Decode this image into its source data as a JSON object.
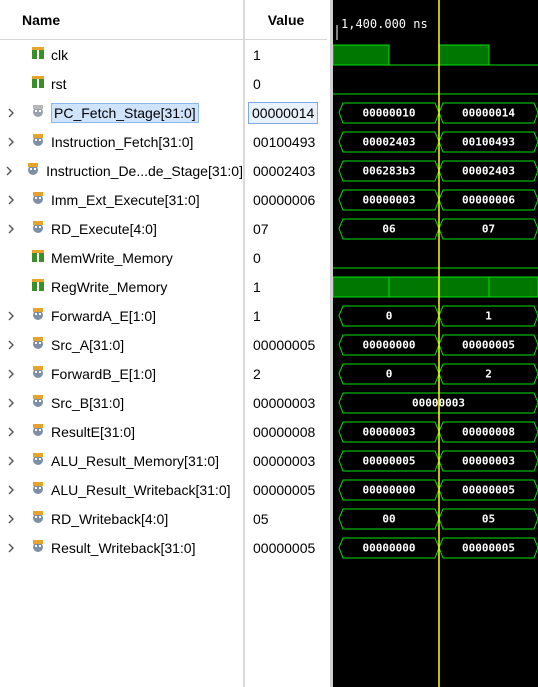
{
  "columns": {
    "name_header": "Name",
    "value_header": "Value"
  },
  "timeline": {
    "cursor_label": "1,400.000 ns"
  },
  "colors": {
    "wave": "#00e000",
    "bus_fill": "#000000",
    "high_fill": "#007700",
    "cursor": "#ffff00",
    "background": "#000000"
  },
  "signals": [
    {
      "name": "clk",
      "value": "1",
      "kind": "bit",
      "icon": "logic-bit-icon",
      "expandable": false,
      "waves": [
        1,
        0,
        1,
        0
      ]
    },
    {
      "name": "rst",
      "value": "0",
      "kind": "bit",
      "icon": "logic-bit-icon",
      "expandable": false,
      "waves": [
        0,
        0,
        0,
        0
      ]
    },
    {
      "name": "PC_Fetch_Stage[31:0]",
      "value": "00000014",
      "kind": "bus",
      "icon": "bus-icon",
      "expandable": true,
      "selected": true,
      "segments": [
        "00000010",
        "00000014"
      ]
    },
    {
      "name": "Instruction_Fetch[31:0]",
      "value": "00100493",
      "kind": "bus",
      "icon": "bus-icon",
      "expandable": true,
      "segments": [
        "00002403",
        "00100493"
      ]
    },
    {
      "name": "Instruction_De...de_Stage[31:0]",
      "value": "00002403",
      "kind": "bus",
      "icon": "bus-icon",
      "expandable": true,
      "segments": [
        "006283b3",
        "00002403"
      ]
    },
    {
      "name": "Imm_Ext_Execute[31:0]",
      "value": "00000006",
      "kind": "bus",
      "icon": "bus-icon",
      "expandable": true,
      "segments": [
        "00000003",
        "00000006"
      ]
    },
    {
      "name": "RD_Execute[4:0]",
      "value": "07",
      "kind": "bus",
      "icon": "bus-icon",
      "expandable": true,
      "segments": [
        "06",
        "07"
      ]
    },
    {
      "name": "MemWrite_Memory",
      "value": "0",
      "kind": "bit",
      "icon": "logic-bit-icon",
      "expandable": false,
      "waves": [
        0,
        0,
        0,
        0
      ]
    },
    {
      "name": "RegWrite_Memory",
      "value": "1",
      "kind": "bit",
      "icon": "logic-bit-icon",
      "expandable": false,
      "waves": [
        1,
        1,
        1,
        1
      ]
    },
    {
      "name": "ForwardA_E[1:0]",
      "value": "1",
      "kind": "bus",
      "icon": "bus-icon",
      "expandable": true,
      "segments": [
        "0",
        "1"
      ]
    },
    {
      "name": "Src_A[31:0]",
      "value": "00000005",
      "kind": "bus",
      "icon": "bus-icon",
      "expandable": true,
      "segments": [
        "00000000",
        "00000005"
      ]
    },
    {
      "name": "ForwardB_E[1:0]",
      "value": "2",
      "kind": "bus",
      "icon": "bus-icon",
      "expandable": true,
      "segments": [
        "0",
        "2"
      ]
    },
    {
      "name": "Src_B[31:0]",
      "value": "00000003",
      "kind": "bus",
      "icon": "bus-icon",
      "expandable": true,
      "segments": [
        "00000003"
      ]
    },
    {
      "name": "ResultE[31:0]",
      "value": "00000008",
      "kind": "bus",
      "icon": "bus-icon",
      "expandable": true,
      "segments": [
        "00000003",
        "00000008"
      ]
    },
    {
      "name": "ALU_Result_Memory[31:0]",
      "value": "00000003",
      "kind": "bus",
      "icon": "bus-icon",
      "expandable": true,
      "segments": [
        "00000005",
        "00000003"
      ]
    },
    {
      "name": "ALU_Result_Writeback[31:0]",
      "value": "00000005",
      "kind": "bus",
      "icon": "bus-icon",
      "expandable": true,
      "segments": [
        "00000000",
        "00000005"
      ]
    },
    {
      "name": "RD_Writeback[4:0]",
      "value": "05",
      "kind": "bus",
      "icon": "bus-icon",
      "expandable": true,
      "segments": [
        "00",
        "05"
      ]
    },
    {
      "name": "Result_Writeback[31:0]",
      "value": "00000005",
      "kind": "bus",
      "icon": "bus-icon",
      "expandable": true,
      "segments": [
        "00000000",
        "00000005"
      ]
    }
  ]
}
